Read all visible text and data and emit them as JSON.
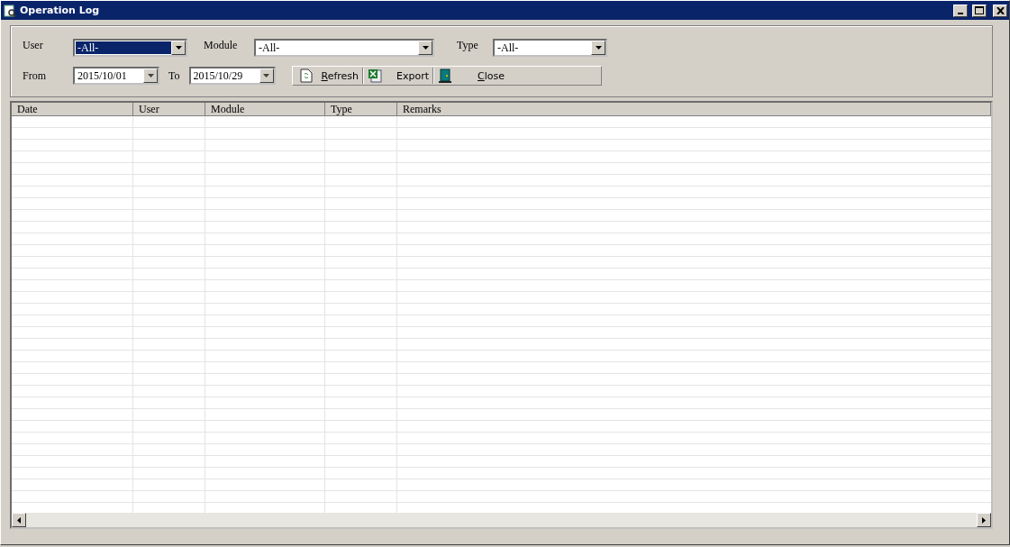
{
  "window": {
    "title": "Operation Log"
  },
  "filters": [
    {
      "label": "User",
      "value": "-All-",
      "focused": true
    },
    {
      "label": "Module",
      "value": "-All-",
      "focused": false
    },
    {
      "label": "Type",
      "value": "-All-",
      "focused": false
    }
  ],
  "range": {
    "from_label": "From",
    "from": "2015/10/01",
    "to_label": "To",
    "to": "2015/10/29"
  },
  "toolbar": [
    {
      "kind": "refresh",
      "label": "Refresh",
      "mnemonic": true
    },
    {
      "kind": "export",
      "label": "Export",
      "mnemonic": false
    },
    {
      "kind": "close",
      "label": "Close",
      "mnemonic": true
    }
  ],
  "table": {
    "columns": [
      "Date",
      "User",
      "Module",
      "Type",
      "Remarks"
    ]
  }
}
